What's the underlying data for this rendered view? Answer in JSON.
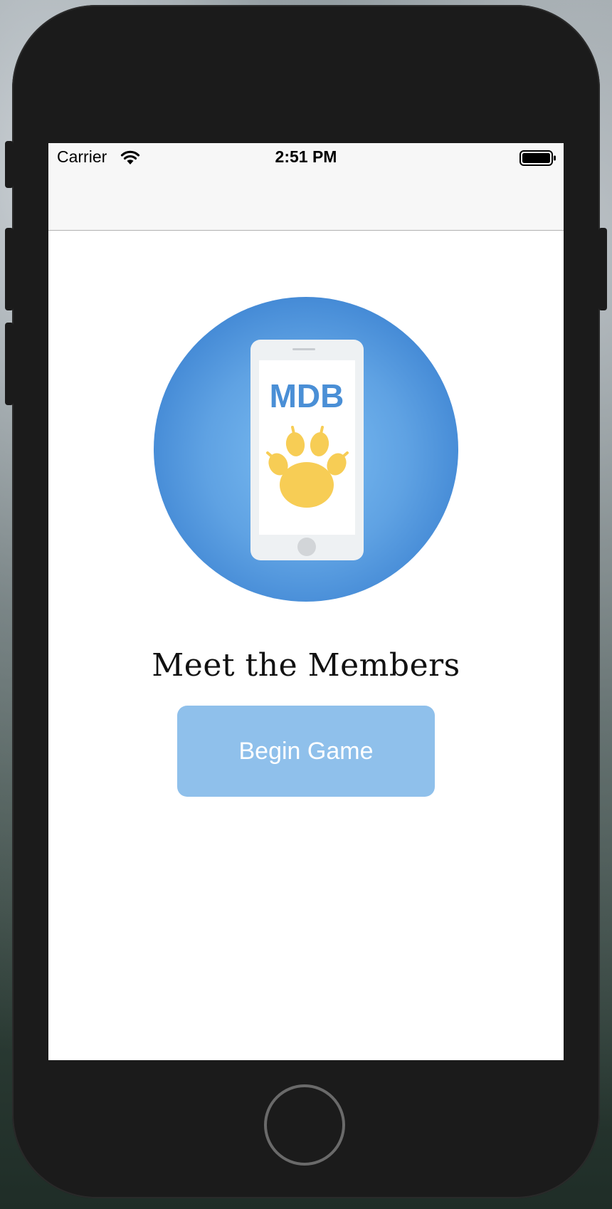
{
  "status_bar": {
    "carrier": "Carrier",
    "time": "2:51 PM",
    "wifi_icon": "wifi-icon",
    "battery_icon": "battery-full-icon"
  },
  "logo": {
    "text": "MDB",
    "icon": "paw-icon",
    "colors": {
      "circle": "#5a9ee0",
      "paw": "#f7cd55",
      "text": "#4a8fd6"
    }
  },
  "main": {
    "title": "Meet the Members",
    "begin_button_label": "Begin Game"
  },
  "theme": {
    "button_bg": "#8fc0eb",
    "button_text": "#ffffff"
  }
}
